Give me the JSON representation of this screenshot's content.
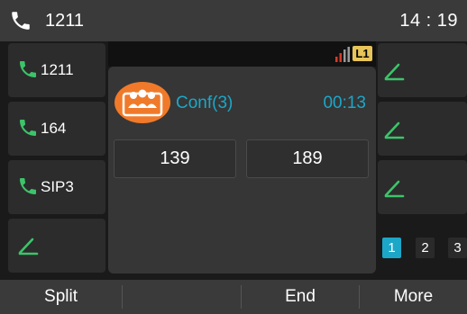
{
  "status_bar": {
    "account_label": "1211",
    "time": "14 : 19"
  },
  "left_keys": [
    {
      "label": "1211",
      "icon": "phone-icon"
    },
    {
      "label": "164",
      "icon": "phone-icon"
    },
    {
      "label": "SIP3",
      "icon": "phone-icon"
    },
    {
      "label": "",
      "icon": "edit-icon"
    }
  ],
  "right_keys": [
    {
      "icon": "edit-icon"
    },
    {
      "icon": "edit-icon"
    },
    {
      "icon": "edit-icon"
    }
  ],
  "line_badge": "L1",
  "call": {
    "name": "Conf(3)",
    "timer": "00:13",
    "participants": [
      "139",
      "189"
    ]
  },
  "pages": [
    "1",
    "2",
    "3"
  ],
  "active_page": "1",
  "softkeys": [
    "Split",
    "",
    "End",
    "More"
  ],
  "colors": {
    "accent": "#1ca7c8",
    "call_green": "#3cc46a",
    "avatar_orange": "#f07a2a",
    "badge_yellow": "#e8c55a"
  }
}
